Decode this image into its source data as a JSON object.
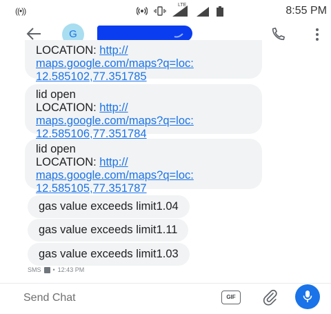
{
  "status_bar": {
    "signal_glyph": "((•))",
    "network": "LTE",
    "time": "8:55 PM"
  },
  "header": {
    "avatar_letter": "G"
  },
  "messages": [
    {
      "text": "LOCATION: ",
      "link": [
        "http://",
        "maps.google.com/maps?q=loc:",
        "12.585102,77.351785"
      ]
    },
    {
      "text": "lid open",
      "text2": "LOCATION: ",
      "link": [
        "http://",
        "maps.google.com/maps?q=loc:",
        "12.585106,77.351784"
      ]
    },
    {
      "text": "lid open",
      "text2": "LOCATION: ",
      "link": [
        "http://",
        "maps.google.com/maps?q=loc:",
        "12.585105,77.351787"
      ]
    },
    {
      "text": "gas value exceeds limit1.04"
    },
    {
      "text": "gas value exceeds limit1.11"
    },
    {
      "text": "gas value exceeds limit1.03"
    }
  ],
  "message_meta": {
    "type": "SMS",
    "separator": "•",
    "time": "12:43 PM"
  },
  "composer": {
    "placeholder": "Send Chat",
    "gif_label": "GIF"
  },
  "colors": {
    "accent": "#1a73e8",
    "bubble": "#f1f3f4",
    "redaction": "#0b3df0",
    "avatar_bg": "#a9ddf0"
  },
  "icons": [
    "back-arrow-icon",
    "call-icon",
    "more-vert-icon",
    "attach-icon",
    "mic-icon",
    "sim-icon"
  ]
}
